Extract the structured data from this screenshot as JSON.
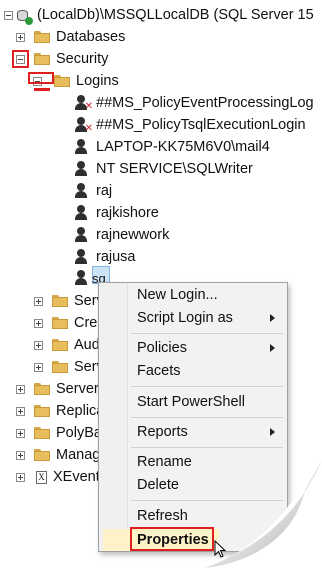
{
  "tree": {
    "server": "(LocalDb)\\MSSQLLocalDB (SQL Server 15",
    "databases": "Databases",
    "security": "Security",
    "logins": "Logins",
    "login_items": [
      "##MS_PolicyEventProcessingLog",
      "##MS_PolicyTsqlExecutionLogin",
      "LAPTOP-KK75M6V0\\mail4",
      "NT SERVICE\\SQLWriter",
      "raj",
      "rajkishore",
      "rajnewwork",
      "rajusa",
      "sq"
    ],
    "security_children": [
      "Serv",
      "Cred",
      "Aud",
      "Serv"
    ],
    "server_children": [
      "Server",
      "Replica",
      "PolyBa",
      "Manag",
      "XEvent"
    ]
  },
  "context_menu": {
    "items": [
      {
        "label": "New Login...",
        "submenu": false
      },
      {
        "label": "Script Login as",
        "submenu": true
      },
      {
        "label": "Policies",
        "submenu": true
      },
      {
        "label": "Facets",
        "submenu": false
      },
      {
        "label": "Start PowerShell",
        "submenu": false
      },
      {
        "label": "Reports",
        "submenu": true
      },
      {
        "label": "Rename",
        "submenu": false
      },
      {
        "label": "Delete",
        "submenu": false
      },
      {
        "label": "Refresh",
        "submenu": false
      },
      {
        "label": "Properties",
        "submenu": false
      }
    ]
  },
  "colors": {
    "highlight_red": "#e02020",
    "selection": "#cce4f7",
    "menu_background": "#f2f2f2"
  }
}
